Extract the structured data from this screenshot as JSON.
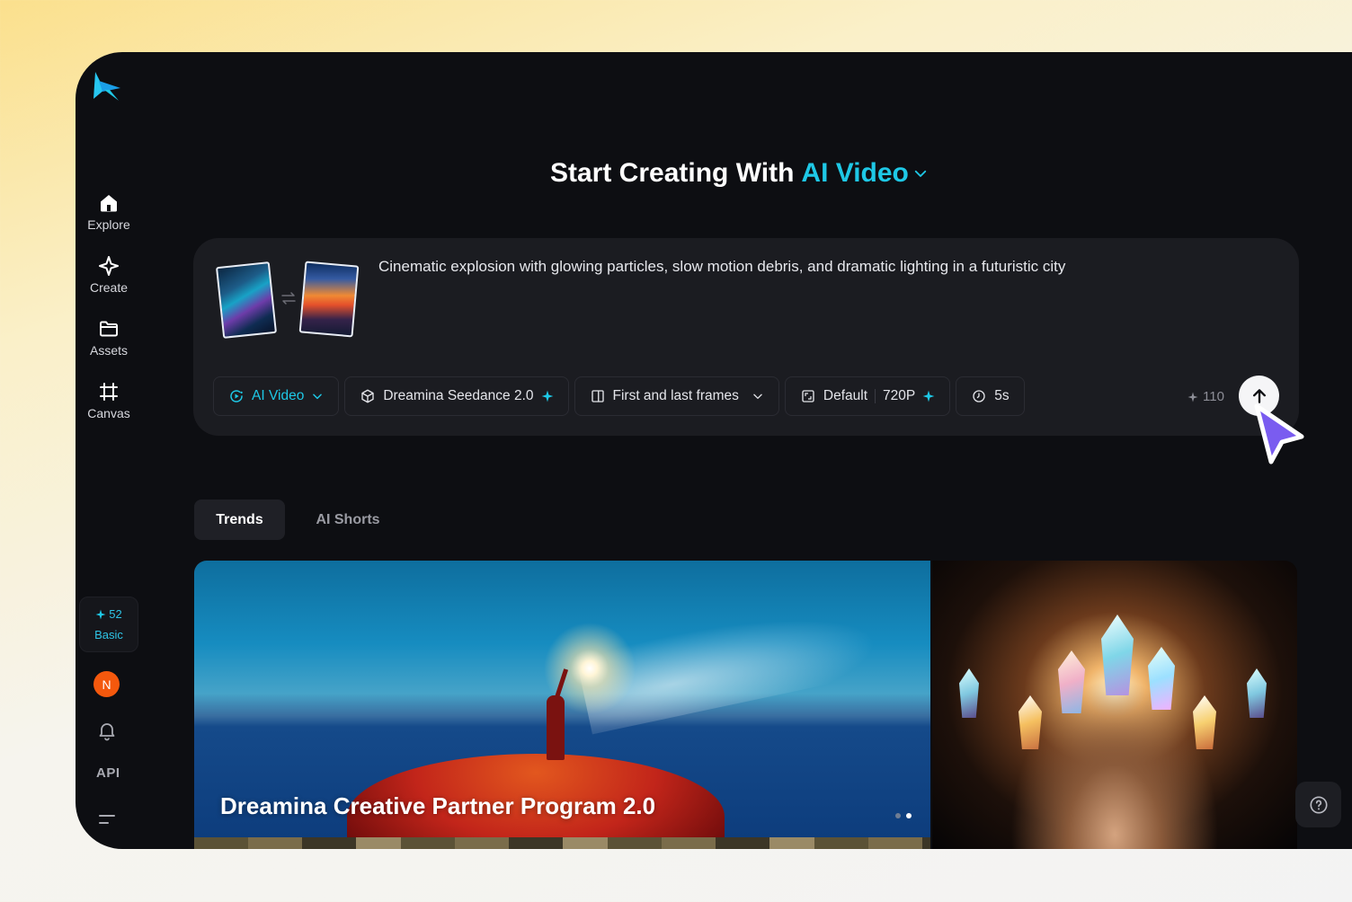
{
  "sidebar": {
    "items": [
      {
        "label": "Explore",
        "icon": "home-icon"
      },
      {
        "label": "Create",
        "icon": "sparkle-icon"
      },
      {
        "label": "Assets",
        "icon": "folder-icon"
      },
      {
        "label": "Canvas",
        "icon": "canvas-icon"
      }
    ],
    "credits": "52",
    "plan": "Basic",
    "avatar_initial": "N",
    "api_label": "API"
  },
  "header": {
    "title_prefix": "Start Creating With",
    "title_accent": "AI Video"
  },
  "prompt_card": {
    "prompt_text": "Cinematic explosion with glowing particles, slow motion debris, and dramatic lighting in a futuristic city",
    "mode": "AI Video",
    "model": "Dreamina Seedance 2.0",
    "frames": "First and last frames",
    "ratio": "Default",
    "resolution": "720P",
    "duration": "5s",
    "cost": "110"
  },
  "tabs": [
    {
      "label": "Trends",
      "active": true
    },
    {
      "label": "AI Shorts",
      "active": false
    }
  ],
  "banner": {
    "title": "Dreamina Creative Partner Program 2.0",
    "slide_count": 2,
    "active_slide": 2
  },
  "colors": {
    "accent": "#1ec8e6",
    "background": "#0d0e12",
    "card": "#1b1c21",
    "avatar": "#f4580d"
  }
}
